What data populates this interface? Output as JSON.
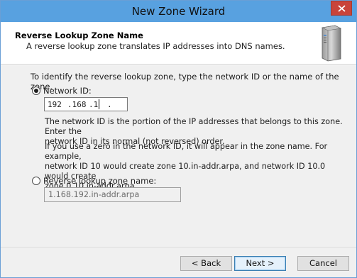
{
  "window": {
    "title": "New Zone Wizard",
    "close_icon": "close-icon"
  },
  "header": {
    "title": "Reverse Lookup Zone Name",
    "subtitle": "A reverse lookup zone translates IP addresses into DNS names.",
    "icon": "server-icon"
  },
  "main": {
    "intro": "To identify the reverse lookup zone, type the network ID or the name of the zone.",
    "network_id_option": {
      "label": "Network ID:",
      "selected": true
    },
    "network_id_octets": [
      "192",
      ".168",
      ".1",
      "."
    ],
    "para1_line1": "The network ID is the portion of the IP addresses that belongs to this zone. Enter the",
    "para1_line2": "network ID in its normal (not reversed) order.",
    "para2_line1": "If you use a zero in the network ID, it will appear in the zone name. For example,",
    "para2_line2": "network ID 10 would create zone 10.in-addr.arpa, and network ID 10.0 would create",
    "para2_line3": "zone 0.10.in-addr.arpa.",
    "reverse_option": {
      "label": "Reverse lookup zone name:",
      "selected": false
    },
    "reverse_value": "1.168.192.in-addr.arpa"
  },
  "footer": {
    "back": "< Back",
    "next": "Next >",
    "cancel": "Cancel"
  }
}
